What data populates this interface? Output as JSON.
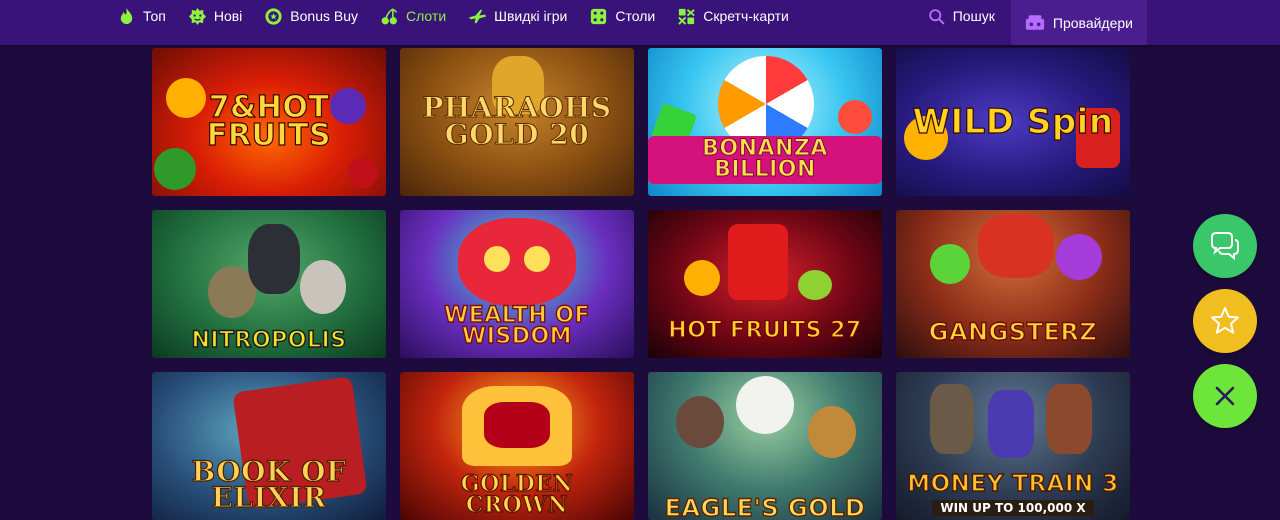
{
  "nav": {
    "items": [
      {
        "label": "Топ",
        "icon": "flame-icon",
        "active": false
      },
      {
        "label": "Нові",
        "icon": "new-badge-icon",
        "active": false
      },
      {
        "label": "Bonus Buy",
        "icon": "bonus-coin-icon",
        "active": false
      },
      {
        "label": "Слоти",
        "icon": "cherries-icon",
        "active": true
      },
      {
        "label": "Швидкі ігри",
        "icon": "plane-icon",
        "active": false
      },
      {
        "label": "Столи",
        "icon": "dice-icon",
        "active": false
      },
      {
        "label": "Скретч-карти",
        "icon": "scratch-card-icon",
        "active": false
      }
    ],
    "search_label": "Пошук",
    "providers_label": "Провайдери",
    "active_color": "#8cf23f"
  },
  "games": [
    {
      "title": "7&HOT FRUITS",
      "name": "7 & Hot Fruits"
    },
    {
      "title": "PHARAOHS GOLD 20",
      "name": "Pharaohs Gold 20"
    },
    {
      "title": "BONANZA BILLION",
      "name": "Bonanza Billion"
    },
    {
      "title": "WILD Spin",
      "name": "Wild Spin"
    },
    {
      "title": "NITROPOLIS",
      "name": "Nitropolis"
    },
    {
      "title": "WEALTH OF WISDOM",
      "name": "Wealth of Wisdom"
    },
    {
      "title": "HOT FRUITS 27",
      "name": "Hot Fruits 27"
    },
    {
      "title": "GANGSTERZ",
      "name": "Gangsterz"
    },
    {
      "title": "BOOK OF ELIXIR",
      "name": "Book of Elixir"
    },
    {
      "title": "GOLDEN CROWN",
      "name": "Golden Crown"
    },
    {
      "title": "EAGLE'S GOLD",
      "name": "Eagle's Gold"
    },
    {
      "title": "MONEY TRAIN 3",
      "name": "Money Train 3",
      "subtitle": "WIN UP TO 100,000 X"
    }
  ],
  "fabs": [
    {
      "name": "chat",
      "icon": "chat-bubbles-icon",
      "color": "#3ac76a"
    },
    {
      "name": "favorites",
      "icon": "star-icon",
      "color": "#f0be1e"
    },
    {
      "name": "close",
      "icon": "close-icon",
      "color": "#6ee53a"
    }
  ]
}
